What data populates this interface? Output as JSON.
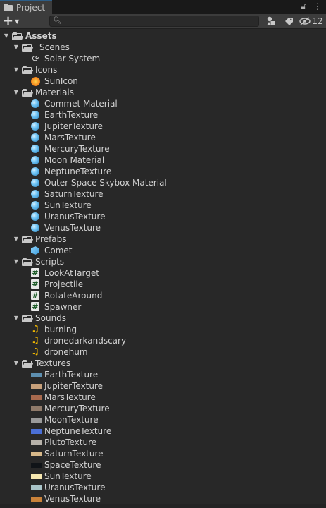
{
  "window": {
    "tab_title": "Project",
    "lock_icon": "lock-icon",
    "menu_icon": "kebab-menu-icon"
  },
  "toolbar": {
    "add_icon": "plus-icon",
    "search_value": "",
    "search_placeholder": "",
    "hidden_count": "12"
  },
  "tree": {
    "root": "Assets",
    "folders": [
      {
        "name": "_Scenes",
        "items": [
          {
            "name": "Solar System",
            "type": "scene"
          }
        ]
      },
      {
        "name": "Icons",
        "items": [
          {
            "name": "SunIcon",
            "type": "sunicon"
          }
        ]
      },
      {
        "name": "Materials",
        "items": [
          {
            "name": "Commet Material",
            "type": "material"
          },
          {
            "name": "EarthTexture",
            "type": "material"
          },
          {
            "name": "JupiterTexture",
            "type": "material"
          },
          {
            "name": "MarsTexture",
            "type": "material"
          },
          {
            "name": "MercuryTexture",
            "type": "material"
          },
          {
            "name": "Moon Material",
            "type": "material"
          },
          {
            "name": "NeptuneTexture",
            "type": "material"
          },
          {
            "name": "Outer Space Skybox Material",
            "type": "material"
          },
          {
            "name": "SaturnTexture",
            "type": "material"
          },
          {
            "name": "SunTexture",
            "type": "material"
          },
          {
            "name": "UranusTexture",
            "type": "material"
          },
          {
            "name": "VenusTexture",
            "type": "material"
          }
        ]
      },
      {
        "name": "Prefabs",
        "items": [
          {
            "name": "Comet",
            "type": "prefab"
          }
        ]
      },
      {
        "name": "Scripts",
        "items": [
          {
            "name": "LookAtTarget",
            "type": "script"
          },
          {
            "name": "Projectile",
            "type": "script"
          },
          {
            "name": "RotateAround",
            "type": "script"
          },
          {
            "name": "Spawner",
            "type": "script"
          }
        ]
      },
      {
        "name": "Sounds",
        "items": [
          {
            "name": "burning",
            "type": "audio"
          },
          {
            "name": "dronedarkandscary",
            "type": "audio"
          },
          {
            "name": "dronehum",
            "type": "audio"
          }
        ]
      },
      {
        "name": "Textures",
        "items": [
          {
            "name": "EarthTexture",
            "type": "texture",
            "color": "#5d8fb0"
          },
          {
            "name": "JupiterTexture",
            "type": "texture",
            "color": "#c7a07a"
          },
          {
            "name": "MarsTexture",
            "type": "texture",
            "color": "#a86a4e"
          },
          {
            "name": "MercuryTexture",
            "type": "texture",
            "color": "#8f7a6a"
          },
          {
            "name": "MoonTexture",
            "type": "texture",
            "color": "#9a9a9a"
          },
          {
            "name": "NeptuneTexture",
            "type": "texture",
            "color": "#4a6fd6"
          },
          {
            "name": "PlutoTexture",
            "type": "texture",
            "color": "#b7b2aa"
          },
          {
            "name": "SaturnTexture",
            "type": "texture",
            "color": "#d8b98a"
          },
          {
            "name": "SpaceTexture",
            "type": "texture",
            "color": "#101418"
          },
          {
            "name": "SunTexture",
            "type": "texture",
            "color": "#f6e7b0"
          },
          {
            "name": "UranusTexture",
            "type": "texture",
            "color": "#a9c4c8"
          },
          {
            "name": "VenusTexture",
            "type": "texture",
            "color": "#c9823a"
          }
        ]
      }
    ]
  }
}
